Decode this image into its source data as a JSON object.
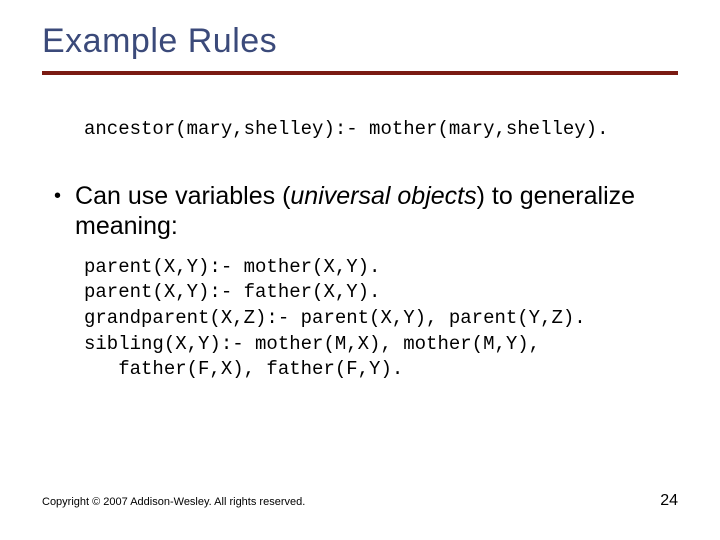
{
  "title": "Example Rules",
  "code_top": "ancestor(mary,shelley):- mother(mary,shelley).",
  "bullet": {
    "pre": "Can use variables (",
    "italic": "universal objects",
    "post": ") to generalize meaning:"
  },
  "code_bottom": "parent(X,Y):- mother(X,Y).\nparent(X,Y):- father(X,Y).\ngrandparent(X,Z):- parent(X,Y), parent(Y,Z).\nsibling(X,Y):- mother(M,X), mother(M,Y),\n   father(F,X), father(F,Y).",
  "footer": {
    "copyright": "Copyright © 2007 Addison-Wesley. All rights reserved.",
    "page": "24"
  }
}
